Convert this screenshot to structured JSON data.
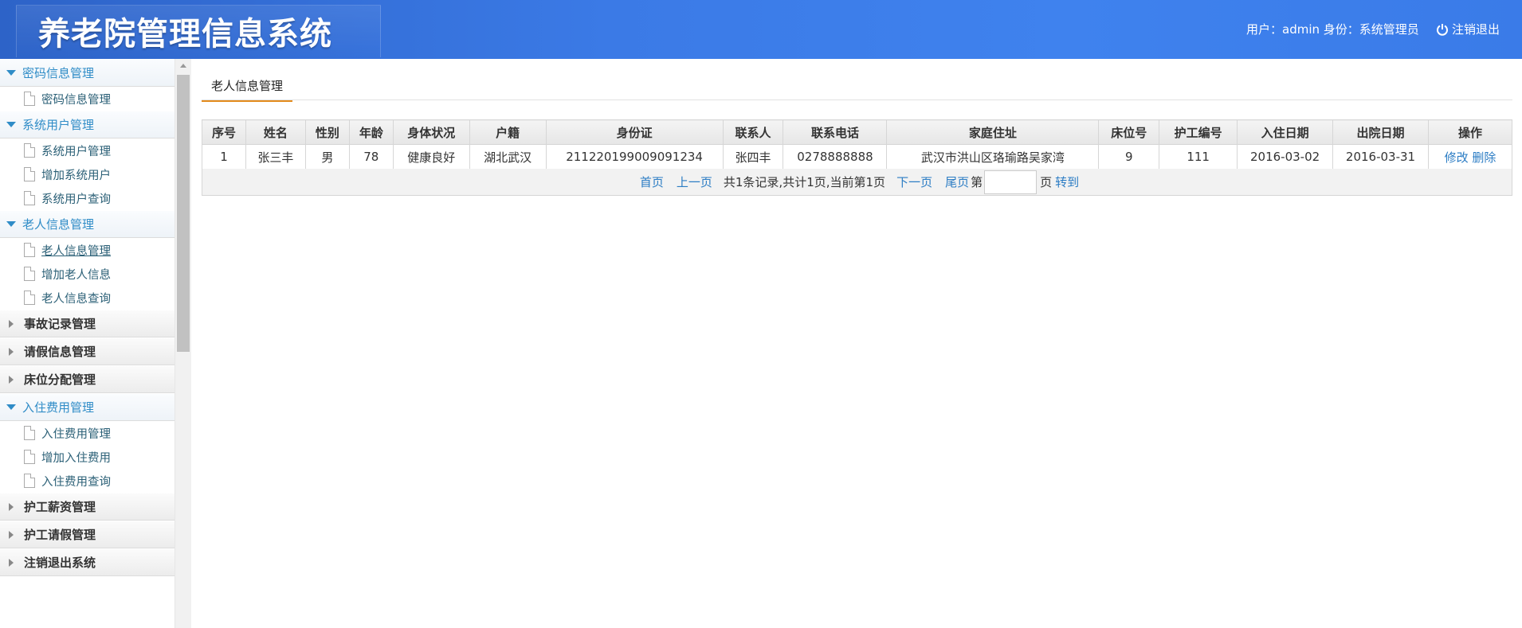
{
  "header": {
    "title": "养老院管理信息系统",
    "user_info": "用户：admin 身份：系统管理员",
    "logout_label": "注销退出"
  },
  "sidebar": {
    "groups": [
      {
        "label": "密码信息管理",
        "open": true,
        "items": [
          "密码信息管理"
        ]
      },
      {
        "label": "系统用户管理",
        "open": true,
        "items": [
          "系统用户管理",
          "增加系统用户",
          "系统用户查询"
        ]
      },
      {
        "label": "老人信息管理",
        "open": true,
        "items": [
          "老人信息管理",
          "增加老人信息",
          "老人信息查询"
        ]
      },
      {
        "label": "事故记录管理",
        "open": false,
        "items": []
      },
      {
        "label": "请假信息管理",
        "open": false,
        "items": []
      },
      {
        "label": "床位分配管理",
        "open": false,
        "items": []
      },
      {
        "label": "入住费用管理",
        "open": true,
        "items": [
          "入住费用管理",
          "增加入住费用",
          "入住费用查询"
        ]
      },
      {
        "label": "护工薪资管理",
        "open": false,
        "items": []
      },
      {
        "label": "护工请假管理",
        "open": false,
        "items": []
      },
      {
        "label": "注销退出系统",
        "open": false,
        "items": []
      }
    ],
    "active_item": "老人信息管理"
  },
  "main": {
    "tab_title": "老人信息管理",
    "table": {
      "columns": [
        "序号",
        "姓名",
        "性别",
        "年龄",
        "身体状况",
        "户籍",
        "身份证",
        "联系人",
        "联系电话",
        "家庭住址",
        "床位号",
        "护工编号",
        "入住日期",
        "出院日期",
        "操作"
      ],
      "rows": [
        [
          "1",
          "张三丰",
          "男",
          "78",
          "健康良好",
          "湖北武汉",
          "211220199009091234",
          "张四丰",
          "0278888888",
          "武汉市洪山区珞瑜路吴家湾",
          "9",
          "111",
          "2016-03-02",
          "2016-03-31"
        ]
      ],
      "row_actions": {
        "edit": "修改",
        "delete": "删除"
      }
    },
    "pager": {
      "first": "首页",
      "prev": "上一页",
      "summary": "共1条记录,共计1页,当前第1页",
      "next": "下一页",
      "last": "尾页",
      "page_prefix": "第",
      "page_input_value": "",
      "page_suffix": "页",
      "go": "转到"
    }
  }
}
